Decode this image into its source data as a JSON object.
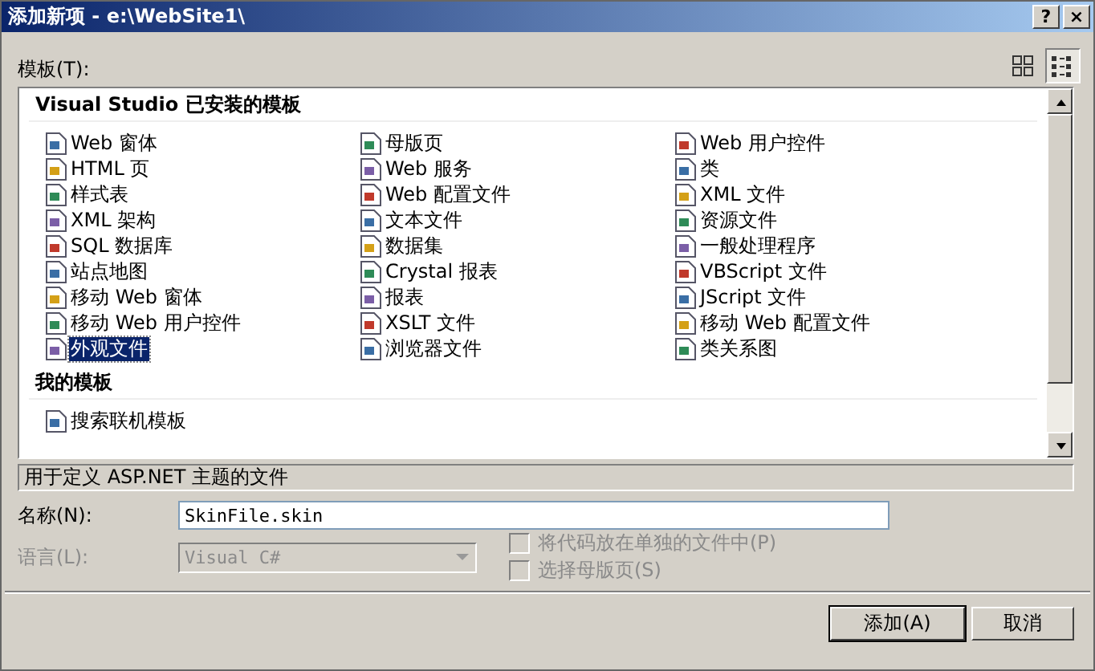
{
  "window": {
    "title": "添加新项 - e:\\WebSite1\\",
    "help": "?",
    "close": "×"
  },
  "templates_label": "模板(T):",
  "sections": [
    {
      "title": "Visual Studio 已安装的模板",
      "items": [
        {
          "label": "Web 窗体",
          "selected": false
        },
        {
          "label": "母版页",
          "selected": false
        },
        {
          "label": "Web 用户控件",
          "selected": false
        },
        {
          "label": "HTML 页",
          "selected": false
        },
        {
          "label": "Web 服务",
          "selected": false
        },
        {
          "label": "类",
          "selected": false
        },
        {
          "label": "样式表",
          "selected": false
        },
        {
          "label": "Web 配置文件",
          "selected": false
        },
        {
          "label": "XML 文件",
          "selected": false
        },
        {
          "label": "XML 架构",
          "selected": false
        },
        {
          "label": "文本文件",
          "selected": false
        },
        {
          "label": "资源文件",
          "selected": false
        },
        {
          "label": "SQL 数据库",
          "selected": false
        },
        {
          "label": "数据集",
          "selected": false
        },
        {
          "label": "一般处理程序",
          "selected": false
        },
        {
          "label": "站点地图",
          "selected": false
        },
        {
          "label": "Crystal 报表",
          "selected": false
        },
        {
          "label": "VBScript 文件",
          "selected": false
        },
        {
          "label": "移动 Web 窗体",
          "selected": false
        },
        {
          "label": "报表",
          "selected": false
        },
        {
          "label": "JScript 文件",
          "selected": false
        },
        {
          "label": "移动 Web 用户控件",
          "selected": false
        },
        {
          "label": "XSLT 文件",
          "selected": false
        },
        {
          "label": "移动 Web 配置文件",
          "selected": false
        },
        {
          "label": "外观文件",
          "selected": true
        },
        {
          "label": "浏览器文件",
          "selected": false
        },
        {
          "label": "类关系图",
          "selected": false
        }
      ]
    },
    {
      "title": "我的模板",
      "items": [
        {
          "label": "搜索联机模板",
          "selected": false
        }
      ]
    }
  ],
  "description": "用于定义 ASP.NET 主题的文件",
  "name_label": "名称(N):",
  "name_value": "SkinFile.skin",
  "language_label": "语言(L):",
  "language_value": "Visual C#",
  "language_disabled": true,
  "options": [
    {
      "label": "将代码放在单独的文件中(P)",
      "checked": false,
      "disabled": true
    },
    {
      "label": "选择母版页(S)",
      "checked": false,
      "disabled": true
    }
  ],
  "buttons": [
    "添加(A)",
    "取消"
  ]
}
